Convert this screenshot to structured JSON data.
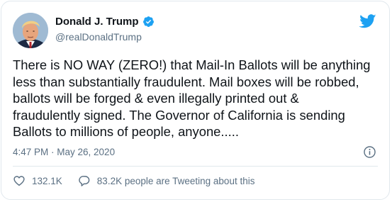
{
  "user": {
    "display_name": "Donald J. Trump",
    "handle": "@realDonaldTrump"
  },
  "icons": {
    "verified": "verified-badge-icon",
    "brand": "twitter-bird-icon",
    "info": "info-icon",
    "like": "heart-icon",
    "reply": "speech-bubble-icon"
  },
  "tweet": {
    "text": "There is NO WAY (ZERO!) that Mail-In Ballots will be anything\nless than substantially fraudulent. Mail boxes will be robbed,\nballots will be forged & even illegally printed out &\nfraudulently signed. The Governor of California is sending\nBallots to millions of people, anyone.....",
    "timestamp": "4:47 PM · May 26, 2020"
  },
  "stats": {
    "likes": "132.1K",
    "tweeting": "83.2K people are Tweeting about this"
  },
  "colors": {
    "brand_blue": "#1da1f2",
    "secondary_text": "#5b7083",
    "border": "#e1e8ed"
  }
}
